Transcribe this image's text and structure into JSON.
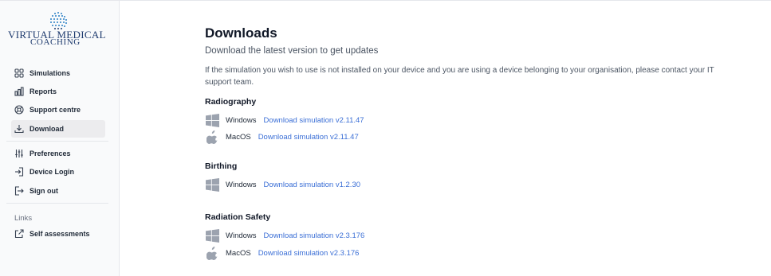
{
  "brand": {
    "line1": "VIRTUAL MEDICAL",
    "line2": "COACHING",
    "accent_color": "#1e3a6e"
  },
  "sidebar": {
    "items": [
      {
        "label": "Simulations",
        "icon": "grid-icon"
      },
      {
        "label": "Reports",
        "icon": "bar-chart-icon"
      },
      {
        "label": "Support centre",
        "icon": "lifebuoy-icon"
      },
      {
        "label": "Download",
        "icon": "download-icon",
        "active": true
      },
      {
        "label": "Preferences",
        "icon": "sliders-icon"
      },
      {
        "label": "Device Login",
        "icon": "login-icon"
      },
      {
        "label": "Sign out",
        "icon": "logout-icon"
      }
    ],
    "links_label": "Links",
    "links": [
      {
        "label": "Self assessments",
        "icon": "external-link-icon"
      }
    ]
  },
  "main": {
    "title": "Downloads",
    "subtitle": "Download the latest version to get updates",
    "note": "If the simulation you wish to use is not installed on your device and you are using a device belonging to your organisation, please contact your IT support team.",
    "products": [
      {
        "name": "Radiography",
        "downloads": [
          {
            "os": "Windows",
            "icon": "windows-icon",
            "link": "Download simulation v2.11.47"
          },
          {
            "os": "MacOS",
            "icon": "apple-icon",
            "link": "Download simulation v2.11.47"
          }
        ]
      },
      {
        "name": "Birthing",
        "downloads": [
          {
            "os": "Windows",
            "icon": "windows-icon",
            "link": "Download simulation v1.2.30"
          }
        ]
      },
      {
        "name": "Radiation Safety",
        "downloads": [
          {
            "os": "Windows",
            "icon": "windows-icon",
            "link": "Download simulation v2.3.176"
          },
          {
            "os": "MacOS",
            "icon": "apple-icon",
            "link": "Download simulation v2.3.176"
          }
        ]
      }
    ]
  },
  "colors": {
    "link": "#3b6fd6",
    "sidebar_bg": "#f9fafb",
    "active_bg": "#ececee"
  }
}
